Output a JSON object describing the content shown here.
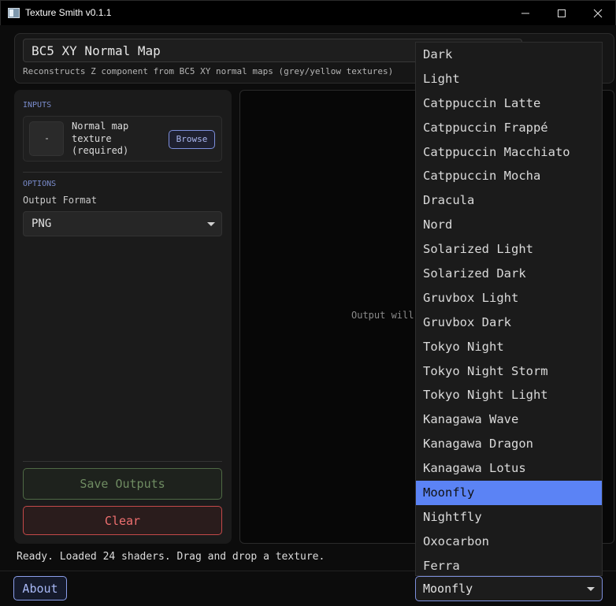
{
  "window": {
    "title": "Texture Smith v0.1.1"
  },
  "shader": {
    "selected": "BC5 XY Normal Map",
    "description": "Reconstructs Z component from BC5 XY normal maps (grey/yellow textures)"
  },
  "inputs": {
    "section_label": "INPUTS",
    "normal_map_label": "Normal map texture (required)",
    "browse_label": "Browse"
  },
  "options": {
    "section_label": "OPTIONS",
    "output_format_label": "Output Format",
    "output_format_value": "PNG"
  },
  "actions": {
    "save_label": "Save Outputs",
    "clear_label": "Clear"
  },
  "output": {
    "placeholder": "Output will"
  },
  "status": {
    "text": "Ready. Loaded 24 shaders. Drag and drop a texture."
  },
  "footer": {
    "about_label": "About",
    "theme_value": "Moonfly"
  },
  "theme_dropdown": {
    "options": [
      "Dark",
      "Light",
      "Catppuccin Latte",
      "Catppuccin Frappé",
      "Catppuccin Macchiato",
      "Catppuccin Mocha",
      "Dracula",
      "Nord",
      "Solarized Light",
      "Solarized Dark",
      "Gruvbox Light",
      "Gruvbox Dark",
      "Tokyo Night",
      "Tokyo Night Storm",
      "Tokyo Night Light",
      "Kanagawa Wave",
      "Kanagawa Dragon",
      "Kanagawa Lotus",
      "Moonfly",
      "Nightfly",
      "Oxocarbon",
      "Ferra"
    ],
    "selected": "Moonfly"
  },
  "colors": {
    "accent": "#7d8fdc",
    "highlight": "#5b83f5",
    "save": "#6f8c62",
    "clear": "#f07070"
  }
}
